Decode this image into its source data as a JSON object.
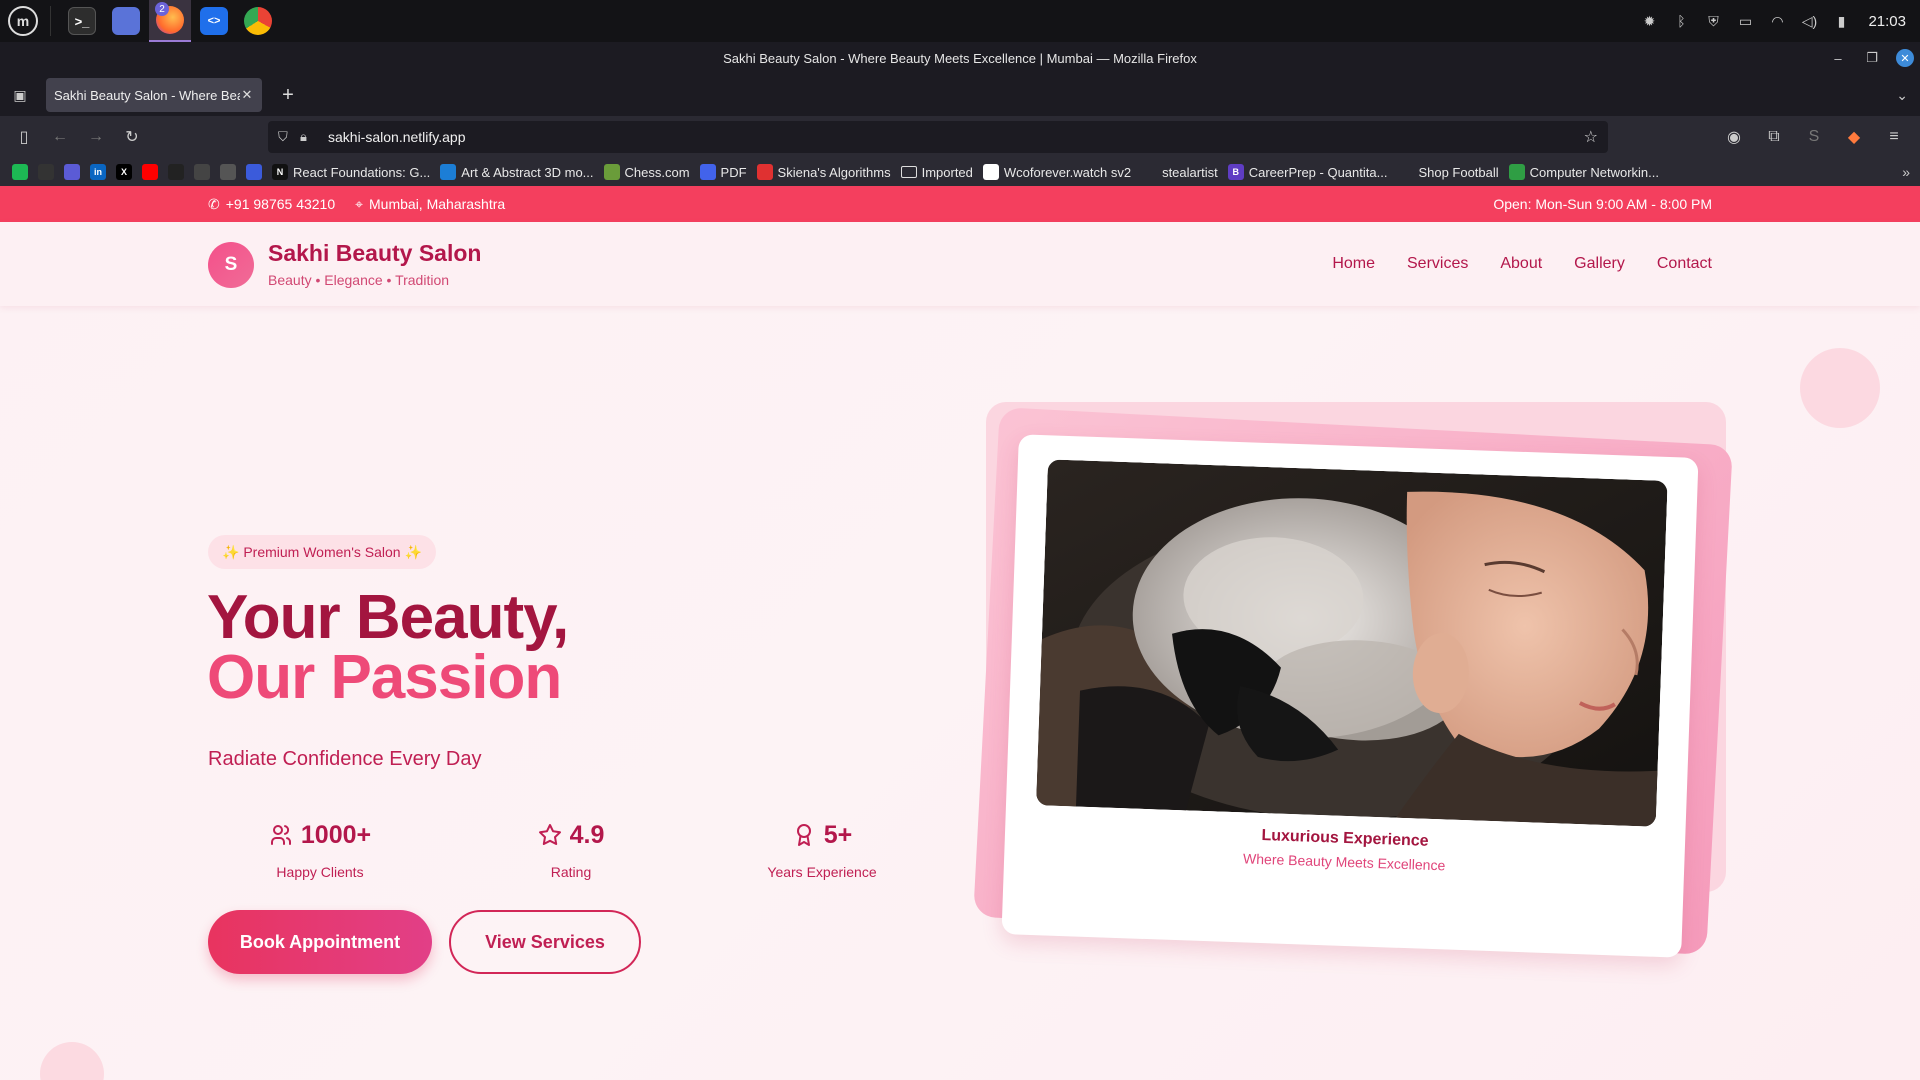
{
  "os": {
    "menu_label": "m",
    "apps": [
      {
        "name": "terminal",
        "glyph": ">_"
      },
      {
        "name": "files",
        "glyph": ""
      },
      {
        "name": "firefox",
        "glyph": "",
        "badge": "2"
      },
      {
        "name": "vscode",
        "glyph": "<>"
      },
      {
        "name": "chrome",
        "glyph": ""
      }
    ],
    "clock": "21:03"
  },
  "window": {
    "title": "Sakhi Beauty Salon - Where Beauty Meets Excellence | Mumbai — Mozilla Firefox"
  },
  "browser": {
    "tab_title": "Sakhi Beauty Salon - Where Beauty Meets Excellence",
    "url": "sakhi-salon.netlify.app",
    "bookmarks": [
      {
        "label": "",
        "color": "#1db954"
      },
      {
        "label": "",
        "color": "#333333"
      },
      {
        "label": "",
        "color": "#5b5bd6"
      },
      {
        "label": "",
        "color": "#0a66c2",
        "glyph": "in"
      },
      {
        "label": "",
        "color": "#000000",
        "glyph": "X"
      },
      {
        "label": "",
        "color": "#ff0000"
      },
      {
        "label": "",
        "color": "#222222"
      },
      {
        "label": "",
        "color": "#444444"
      },
      {
        "label": "",
        "color": "#555555"
      },
      {
        "label": "",
        "color": "#3b5bdb"
      },
      {
        "label": "React Foundations: G...",
        "color": "#111111",
        "glyph": "N"
      },
      {
        "label": "Art & Abstract 3D mo...",
        "color": "#1c7ed6"
      },
      {
        "label": "Chess.com",
        "color": "#6a9c3a"
      },
      {
        "label": "PDF",
        "color": "#4263eb"
      },
      {
        "label": "Skiena's Algorithms",
        "color": "#e03131"
      },
      {
        "label": "Imported",
        "color": "#2b2a33",
        "folder": true
      },
      {
        "label": "Wcoforever.watch sv2",
        "color": "#ffffff"
      },
      {
        "label": "stealartist",
        "color": "#2b2a33"
      },
      {
        "label": "CareerPrep - Quantita...",
        "color": "#5f3dc4",
        "glyph": "B"
      },
      {
        "label": "Shop Football",
        "color": "#2b2a33"
      },
      {
        "label": "Computer Networkin...",
        "color": "#2f9e44"
      }
    ]
  },
  "page": {
    "topbar": {
      "phone": "+91 98765 43210",
      "location": "Mumbai, Maharashtra",
      "hours": "Open: Mon-Sun 9:00 AM - 8:00 PM"
    },
    "brand": {
      "initial": "S",
      "name": "Sakhi Beauty Salon",
      "tagline": "Beauty • Elegance • Tradition"
    },
    "nav": [
      "Home",
      "Services",
      "About",
      "Gallery",
      "Contact"
    ],
    "hero": {
      "badge": "✨ Premium Women's Salon ✨",
      "title_line1": "Your Beauty,",
      "title_line2": "Our Passion",
      "subtitle": "Radiate Confidence Every Day",
      "stats": [
        {
          "icon": "users-icon",
          "value": "1000+",
          "label": "Happy Clients"
        },
        {
          "icon": "star-icon",
          "value": "4.9",
          "label": "Rating"
        },
        {
          "icon": "award-icon",
          "value": "5+",
          "label": "Years Experience"
        }
      ],
      "primary_button": "Book Appointment",
      "secondary_button": "View Services",
      "card_caption_title": "Luxurious Experience",
      "card_caption_sub": "Where Beauty Meets Excellence"
    },
    "colors": {
      "accent": "#f43f5e",
      "brand_dark": "#a3153f",
      "brand_pink": "#ee4a78"
    }
  }
}
